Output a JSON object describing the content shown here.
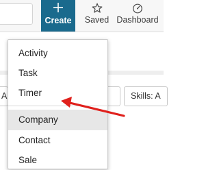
{
  "header": {
    "search_value": "",
    "create_label": "Create",
    "create_icon": "plus-icon",
    "saved_label": "Saved",
    "saved_icon": "star-icon",
    "dashboard_label": "Dashboard",
    "dashboard_icon": "gauge-icon",
    "accent_color": "#1a6a8d"
  },
  "filters": {
    "left_label": "Al",
    "skills_label": "Skills: A"
  },
  "dropdown": {
    "group1": [
      {
        "label": "Activity"
      },
      {
        "label": "Task"
      },
      {
        "label": "Timer"
      }
    ],
    "group2": [
      {
        "label": "Company",
        "highlighted": true
      },
      {
        "label": "Contact"
      },
      {
        "label": "Sale"
      }
    ]
  },
  "annotation": {
    "arrow_color": "#e0201c",
    "points_to": "Company"
  }
}
